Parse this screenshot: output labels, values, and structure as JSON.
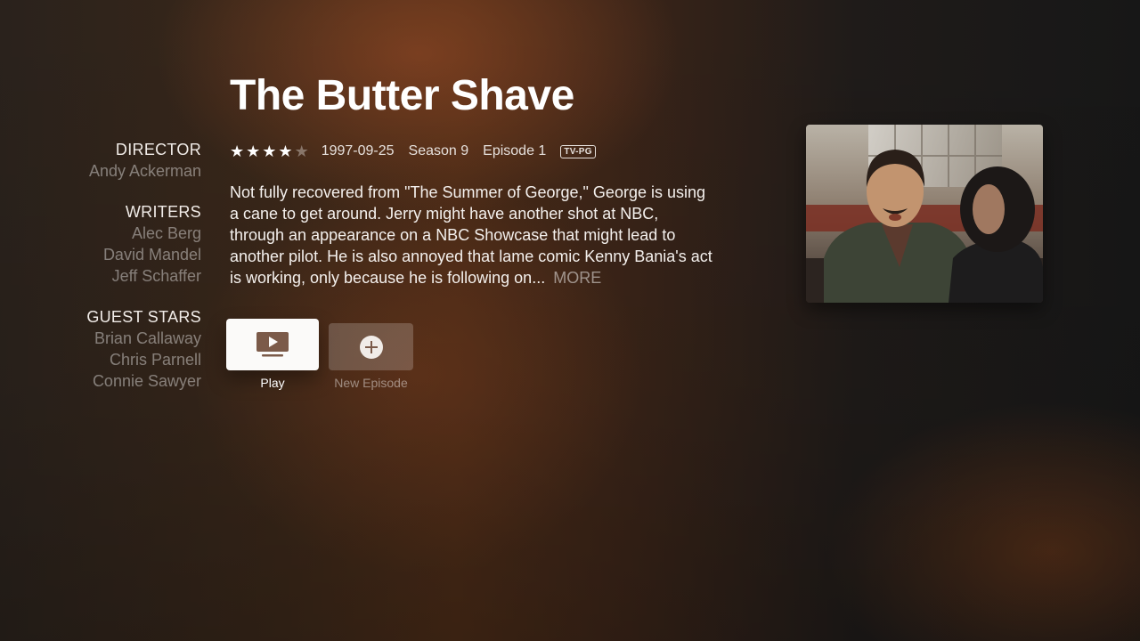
{
  "episode": {
    "title": "The Butter Shave",
    "rating_stars": 4,
    "rating_stars_max": 5,
    "air_date": "1997-09-25",
    "season": "Season 9",
    "episode": "Episode 1",
    "content_rating": "TV-PG",
    "description": "Not fully recovered from \"The Summer of George,\" George is using a cane to get around. Jerry might have another shot at NBC, through an appearance on a NBC Showcase that might lead to another pilot. He is also annoyed that lame comic Kenny Bania's act is working, only because he is following on...",
    "more_label": "MORE"
  },
  "credits": {
    "director_heading": "DIRECTOR",
    "directors": [
      "Andy Ackerman"
    ],
    "writers_heading": "WRITERS",
    "writers": [
      "Alec Berg",
      "David Mandel",
      "Jeff Schaffer"
    ],
    "guest_stars_heading": "GUEST STARS",
    "guest_stars": [
      "Brian Callaway",
      "Chris Parnell",
      "Connie Sawyer"
    ]
  },
  "actions": {
    "play_label": "Play",
    "new_episode_label": "New Episode"
  },
  "icons": {
    "play": "tv-play-icon",
    "add": "plus-circle-icon",
    "star": "star-icon"
  },
  "colors": {
    "accent_button": "#fbfaf9",
    "secondary_button": "rgba(255,255,255,0.2)",
    "muted_text": "rgba(255,255,255,0.42)"
  }
}
